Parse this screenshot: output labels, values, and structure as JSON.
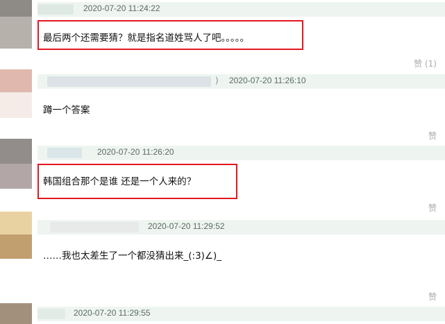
{
  "comments": [
    {
      "timestamp": "2020-07-20 11:24:22",
      "text": "最后两个还需要猜？就是指名道姓骂人了吧。。。。。",
      "like_label": "赞 (1)"
    },
    {
      "timestamp": "2020-07-20 11:26:10",
      "name_suffix": ")",
      "text": "蹲一个答案",
      "like_label": "赞"
    },
    {
      "timestamp": "2020-07-20 11:26:20",
      "text": "韩国组合那个是谁 还是一个人来的？",
      "like_label": "赞"
    },
    {
      "timestamp": "2020-07-20 11:29:52",
      "text": "……我也太差生了一个都没猜出来_(:3)∠)_",
      "like_label": "赞"
    },
    {
      "timestamp": "2020-07-20 11:29:55"
    }
  ],
  "colors": {
    "meta_bar": "#eef5f0",
    "highlight": "#e3171e",
    "like": "#aaaaaa"
  }
}
